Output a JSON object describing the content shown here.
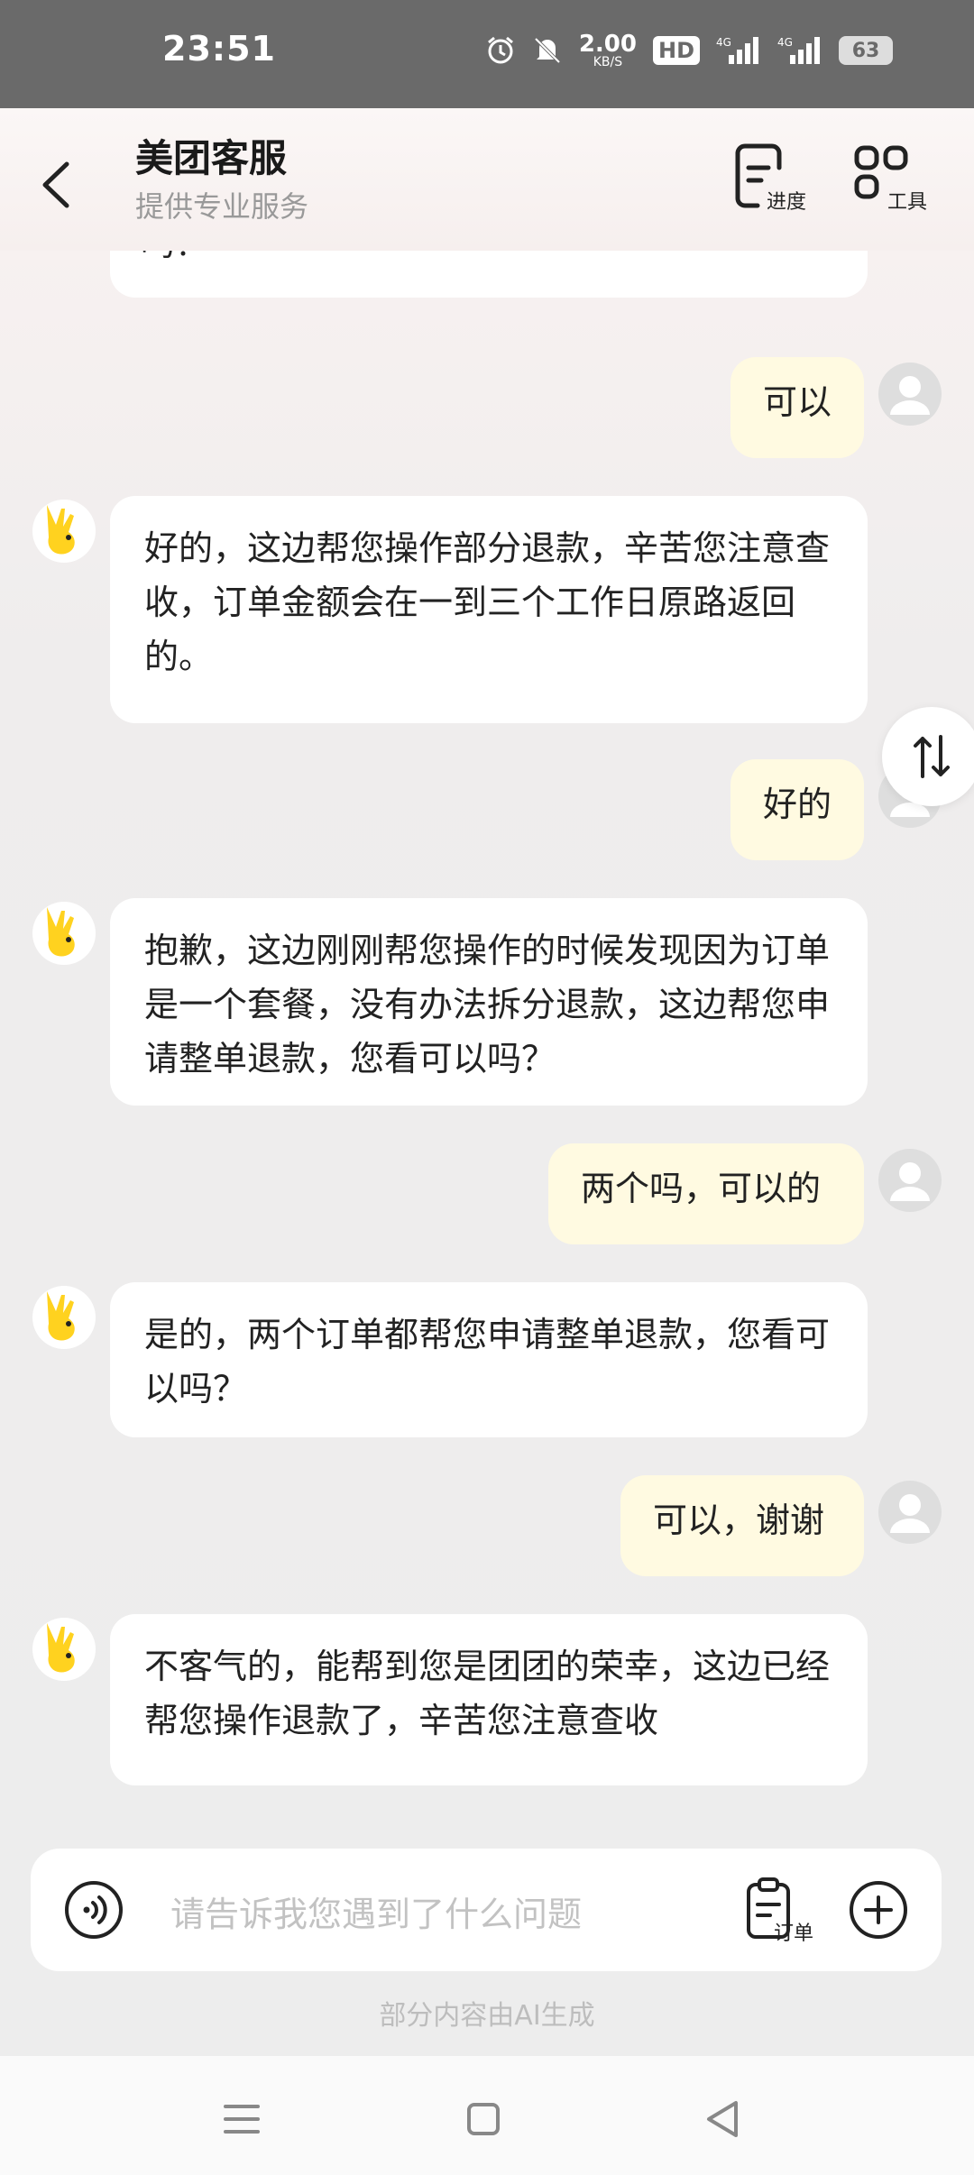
{
  "status_bar": {
    "time": "23:51",
    "net_speed_value": "2.00",
    "net_speed_unit": "KB/S",
    "hd_label": "HD",
    "battery": "63",
    "icons": [
      "alarm-icon",
      "mute-icon",
      "signal-4g-icon",
      "signal-4g-icon"
    ]
  },
  "header": {
    "title": "美团客服",
    "subtitle": "提供专业服务",
    "progress_label": "进度",
    "tools_label": "工具"
  },
  "messages": [
    {
      "from": "agent",
      "text": "吗？"
    },
    {
      "from": "user",
      "text": "可以"
    },
    {
      "from": "agent",
      "text": "好的，这边帮您操作部分退款，辛苦您注意查收，订单金额会在一到三个工作日原路返回的。"
    },
    {
      "from": "user",
      "text": "好的"
    },
    {
      "from": "agent",
      "text": "抱歉，这边刚刚帮您操作的时候发现因为订单是一个套餐，没有办法拆分退款，这边帮您申请整单退款，您看可以吗？"
    },
    {
      "from": "user",
      "text": "两个吗，可以的"
    },
    {
      "from": "agent",
      "text": "是的，两个订单都帮您申请整单退款，您看可以吗？"
    },
    {
      "from": "user",
      "text": "可以，谢谢"
    },
    {
      "from": "agent",
      "text": "不客气的，能帮到您是团团的荣幸，这边已经帮您操作退款了，辛苦您注意查收"
    }
  ],
  "input": {
    "placeholder": "请告诉我您遇到了什么问题",
    "order_label": "订单"
  },
  "ai_note": "部分内容由AI生成",
  "colors": {
    "user_bubble": "#fffae1",
    "agent_bubble": "#ffffff",
    "mascot_yellow": "#ffd21f"
  }
}
